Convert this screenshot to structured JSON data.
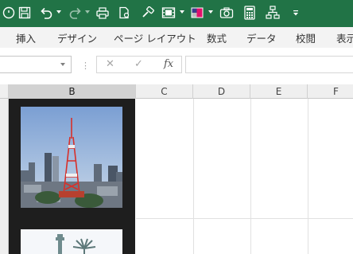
{
  "colors": {
    "ribbon_green": "#217346",
    "tab_bar": "#f3f3f3",
    "selected_column_fill": "#1e1e1e"
  },
  "quick_access_toolbar": {
    "icons": [
      "autosave-icon",
      "save-icon",
      "undo-icon",
      "redo-icon",
      "quick-print-icon",
      "print-preview-icon",
      "format-painter-icon",
      "filmstrip-icon",
      "color-swatch-icon",
      "camera-icon",
      "calculator-icon",
      "org-chart-icon",
      "customize-toolbar-icon"
    ]
  },
  "ribbon_tabs": [
    "挿入",
    "デザイン",
    "ページ レイアウト",
    "数式",
    "データ",
    "校閲",
    "表示"
  ],
  "formula_bar": {
    "name_box_value": "",
    "cancel_symbol": "✕",
    "enter_symbol": "✓",
    "fx_label": "fx",
    "formula_value": ""
  },
  "columns": [
    "B",
    "C",
    "D",
    "E",
    "F"
  ],
  "selected_column": "B",
  "images": [
    {
      "subject": "tokyo-tower-photo",
      "icon": "photo-icon"
    },
    {
      "subject": "statue-of-liberty-photo",
      "icon": "photo-icon"
    }
  ]
}
